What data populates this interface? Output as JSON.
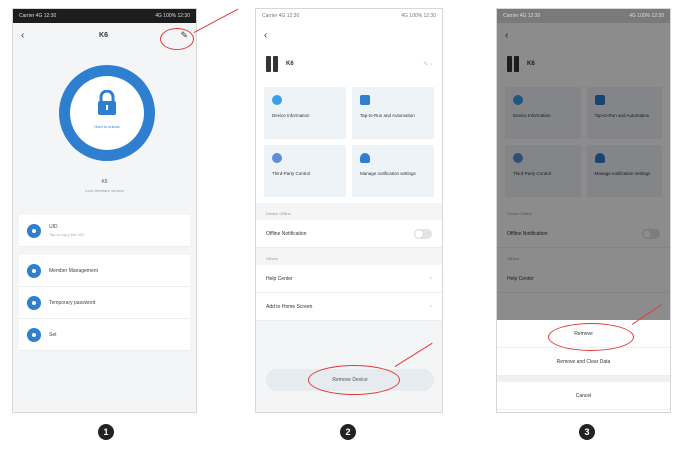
{
  "phone1": {
    "status_left": "Carrier 4G 12:30",
    "status_right": "4G 100% 12:30",
    "title": "K6",
    "lock_label": "Hold to unlock",
    "device_name": "K6",
    "device_sub": "Lock firmware version",
    "rows": [
      {
        "label": "UID",
        "sub": "Tap to copy the UID"
      },
      {
        "label": "Member Management",
        "sub": ""
      },
      {
        "label": "Temporary password",
        "sub": ""
      },
      {
        "label": "Set",
        "sub": ""
      }
    ]
  },
  "phone2": {
    "status_left": "Carrier 4G 12:30",
    "status_right": "4G 100% 12:30",
    "device_name": "K6",
    "tiles": [
      {
        "label": "Device Information",
        "color": "#3a9ee8"
      },
      {
        "label": "Tap-to-Run and Automation",
        "color": "#2f7fd0"
      },
      {
        "label": "Third-Party Control",
        "color": "#5b8fd9"
      },
      {
        "label": "Manage notification settings",
        "color": "#2f7fd0"
      }
    ],
    "section_notify": "Device Offline",
    "offline_label": "Offline Notification",
    "section_other": "Others",
    "help_label": "Help Center",
    "add_home_label": "Add to Home Screen",
    "remove_label": "Remove Device"
  },
  "phone3": {
    "device_name": "K6",
    "tiles": [
      {
        "label": "Device Information",
        "color": "#3a9ee8"
      },
      {
        "label": "Tap-to-Run and Automation",
        "color": "#2f7fd0"
      },
      {
        "label": "Third-Party Control",
        "color": "#5b8fd9"
      },
      {
        "label": "Manage notification settings",
        "color": "#2f7fd0"
      }
    ],
    "section_notify": "Device Offline",
    "offline_label": "Offline Notification",
    "section_other": "Others",
    "help_label": "Help Center",
    "sheet": {
      "remove": "Remove",
      "remove_clear": "Remove and Clear Data",
      "cancel": "Cancel"
    }
  },
  "steps": [
    "1",
    "2",
    "3"
  ],
  "colors": {
    "accent": "#2f7fd0",
    "highlight": "#e13a3a"
  }
}
